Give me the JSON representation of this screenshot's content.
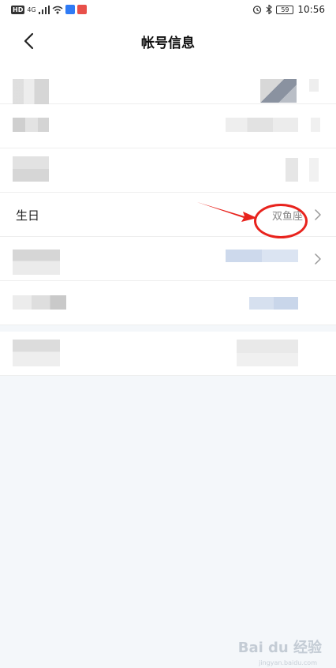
{
  "status_bar": {
    "network_badge": "HD",
    "signal_label": "4G",
    "battery_level": "59",
    "time": "10:56",
    "app_icon_colors": [
      "#2f7bf5",
      "#e8504a"
    ]
  },
  "header": {
    "title": "帐号信息",
    "back_icon": "chevron-left-icon"
  },
  "rows": [
    {
      "label": "",
      "value": "",
      "blurred": true
    },
    {
      "label": "",
      "value": "",
      "blurred": true
    },
    {
      "label": "",
      "value": "",
      "blurred": true
    },
    {
      "label": "生日",
      "value": "双鱼座",
      "has_chevron": true
    },
    {
      "label": "",
      "value": "",
      "blurred": true,
      "has_chevron": true
    },
    {
      "label": "",
      "value": "",
      "blurred": true
    },
    {
      "label": "",
      "value": "",
      "blurred": true
    }
  ],
  "annotation": {
    "highlight_color": "#e8231d"
  },
  "watermark": {
    "brand": "Bai du 经验",
    "url": "jingyan.baidu.com"
  }
}
